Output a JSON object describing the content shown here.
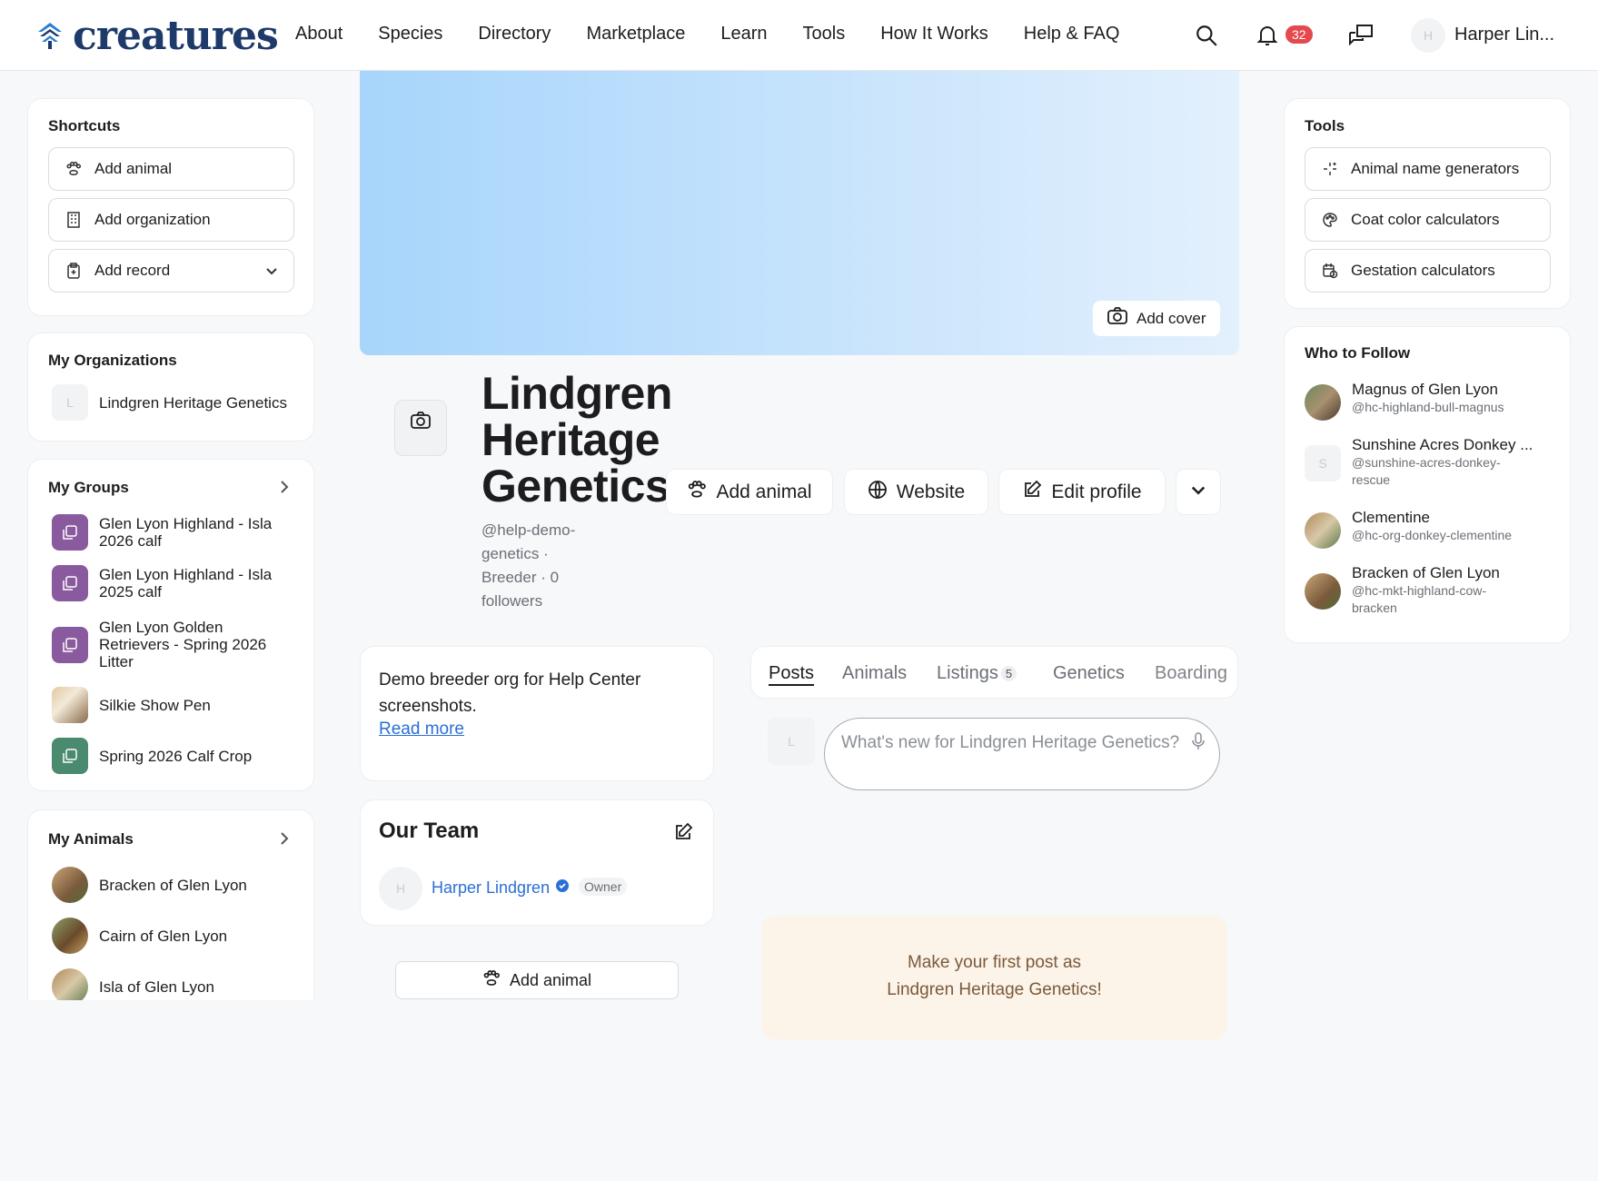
{
  "nav": {
    "logo": "creatures",
    "links": [
      "About",
      "Species",
      "Directory",
      "Marketplace",
      "Learn",
      "Tools",
      "How It Works",
      "Help & FAQ"
    ],
    "notification_count": "32",
    "user_initial": "H",
    "user_name": "Harper Lin..."
  },
  "shortcuts": {
    "title": "Shortcuts",
    "items": [
      "Add animal",
      "Add organization",
      "Add record"
    ]
  },
  "my_orgs": {
    "title": "My Organizations",
    "items": [
      {
        "initial": "L",
        "name": "Lindgren Heritage Genetics"
      }
    ]
  },
  "my_groups": {
    "title": "My Groups",
    "items": [
      "Glen Lyon Highland - Isla 2026 calf",
      "Glen Lyon Highland - Isla 2025 calf",
      "Glen Lyon Golden Retrievers - Spring 2026 Litter",
      "Silkie Show Pen",
      "Spring 2026 Calf Crop"
    ]
  },
  "my_animals": {
    "title": "My Animals",
    "items": [
      "Bracken of Glen Lyon",
      "Cairn of Glen Lyon",
      "Isla of Glen Lyon"
    ]
  },
  "profile": {
    "add_cover": "Add cover",
    "name": "Lindgren Heritage Genetics",
    "meta": "@help-demo-genetics · Breeder · 0 followers",
    "add_animal": "Add animal",
    "website": "Website",
    "edit_profile": "Edit profile"
  },
  "about": {
    "text": "Demo breeder org for Help Center screenshots.",
    "read_more": "Read more"
  },
  "team": {
    "title": "Our Team",
    "member_initial": "H",
    "member_name": "Harper Lindgren",
    "member_role": "Owner"
  },
  "bottom_add_animal": "Add animal",
  "tabs": [
    {
      "label": "Posts"
    },
    {
      "label": "Animals"
    },
    {
      "label": "Listings",
      "count": "5"
    },
    {
      "label": "Genetics"
    },
    {
      "label": "Boarding"
    }
  ],
  "post": {
    "avatar_initial": "L",
    "placeholder": "What's new for Lindgren Heritage Genetics?"
  },
  "first_post": {
    "line1": "Make your first post as",
    "line2": "Lindgren Heritage Genetics!"
  },
  "tools": {
    "title": "Tools",
    "items": [
      "Animal name generators",
      "Coat color calculators",
      "Gestation calculators"
    ]
  },
  "who_to_follow": {
    "title": "Who to Follow",
    "items": [
      {
        "name": "Magnus of Glen Lyon",
        "handle": "@hc-highland-bull-magnus"
      },
      {
        "name": "Sunshine Acres Donkey ...",
        "handle": "@sunshine-acres-donkey-rescue",
        "initial": "S"
      },
      {
        "name": "Clementine",
        "handle": "@hc-org-donkey-clementine"
      },
      {
        "name": "Bracken of Glen Lyon",
        "handle": "@hc-mkt-highland-cow-bracken"
      }
    ]
  },
  "colors": {
    "brand": "#1d3a6b",
    "link": "#2a6fd6",
    "badge": "#e5484d",
    "group_purple": "#8a5a9e",
    "group_green": "#4a8a6e",
    "first_post_bg": "#fcf3e9"
  }
}
